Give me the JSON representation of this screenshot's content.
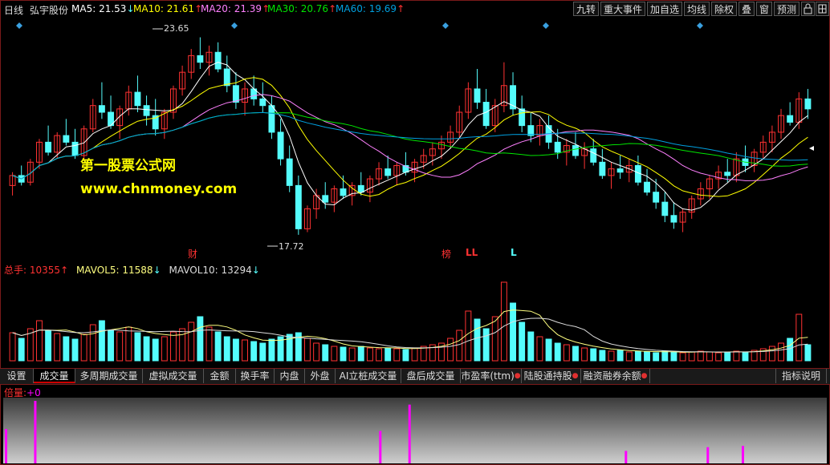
{
  "header": {
    "period": "日线",
    "stock_name": "弘宇股份",
    "ma5": {
      "label": "MA5:",
      "value": "21.53",
      "arrow": "↓"
    },
    "ma10": {
      "label": "MA10:",
      "value": "21.61",
      "arrow": "↑"
    },
    "ma20": {
      "label": "MA20:",
      "value": "21.39",
      "arrow": "↑"
    },
    "ma30": {
      "label": "MA30:",
      "value": "20.76",
      "arrow": "↑"
    },
    "ma60": {
      "label": "MA60:",
      "value": "19.69",
      "arrow": "↑"
    }
  },
  "toolbar": [
    "九转",
    "重大事件",
    "加自选",
    "均线",
    "除权",
    "叠",
    "窗",
    "预测"
  ],
  "chart": {
    "high_label": "23.65",
    "low_label": "17.72",
    "marker_cai": "财",
    "marker_bang": "榜",
    "marker_ll": "LL",
    "marker_l": "L",
    "watermark_cn": "第一股票公式网",
    "watermark_url": "www.chnmoney.com"
  },
  "volume": {
    "total_label": "总手:",
    "total_value": "10355",
    "total_arrow": "↑",
    "mavol5_label": "MAVOL5:",
    "mavol5_value": "11588",
    "mavol5_arrow": "↓",
    "mavol10_label": "MAVOL10:",
    "mavol10_value": "13294",
    "mavol10_arrow": "↓"
  },
  "tabs": [
    {
      "label": "设置",
      "dot": false
    },
    {
      "label": "成交量",
      "dot": false,
      "active": true
    },
    {
      "label": "多周期成交量",
      "dot": false
    },
    {
      "label": "虚拟成交量",
      "dot": false
    },
    {
      "label": "金额",
      "dot": false
    },
    {
      "label": "换手率",
      "dot": false
    },
    {
      "label": "内盘",
      "dot": false
    },
    {
      "label": "外盘",
      "dot": false
    },
    {
      "label": "AI立桩成交量",
      "dot": false
    },
    {
      "label": "盘后成交量",
      "dot": false
    },
    {
      "label": "市盈率(ttm)",
      "dot": true
    },
    {
      "label": "陆股通持股",
      "dot": true
    },
    {
      "label": "融资融券余额",
      "dot": true
    }
  ],
  "indicator_help": "指标说明",
  "bottom": {
    "label": "倍量:",
    "value": "+0"
  },
  "colors": {
    "up": "#ff3232",
    "down": "#54fcfc",
    "ma5": "#ffffff",
    "ma10": "#ffff00",
    "ma20": "#ff80ff",
    "ma30": "#00e600",
    "ma60": "#00a0e0",
    "bottom_bar": "#ff00ff"
  },
  "chart_data": {
    "type": "candlestick",
    "price_range": [
      17.5,
      24.0
    ],
    "candles": [
      [
        19.2,
        19.6,
        18.9,
        19.5
      ],
      [
        19.5,
        19.8,
        19.2,
        19.3
      ],
      [
        19.3,
        20.0,
        19.2,
        19.9
      ],
      [
        19.9,
        20.6,
        19.7,
        20.5
      ],
      [
        20.5,
        21.0,
        20.1,
        20.2
      ],
      [
        20.2,
        20.8,
        20.0,
        20.7
      ],
      [
        20.7,
        21.2,
        20.4,
        20.5
      ],
      [
        20.5,
        20.9,
        20.0,
        20.1
      ],
      [
        20.1,
        21.0,
        20.0,
        20.9
      ],
      [
        20.9,
        21.8,
        20.8,
        21.6
      ],
      [
        21.6,
        22.3,
        21.2,
        21.4
      ],
      [
        21.4,
        21.9,
        20.9,
        21.0
      ],
      [
        21.0,
        21.6,
        20.6,
        21.5
      ],
      [
        21.5,
        22.2,
        21.3,
        22.0
      ],
      [
        22.0,
        22.5,
        21.4,
        21.6
      ],
      [
        21.6,
        21.9,
        21.0,
        21.3
      ],
      [
        21.3,
        21.8,
        20.7,
        20.9
      ],
      [
        20.9,
        21.5,
        20.6,
        21.4
      ],
      [
        21.4,
        22.2,
        21.2,
        22.1
      ],
      [
        22.1,
        22.8,
        21.9,
        22.6
      ],
      [
        22.6,
        23.3,
        22.4,
        23.1
      ],
      [
        23.1,
        23.65,
        22.7,
        22.9
      ],
      [
        22.9,
        23.4,
        22.5,
        23.2
      ],
      [
        23.2,
        23.5,
        22.6,
        22.7
      ],
      [
        22.7,
        23.1,
        22.0,
        22.2
      ],
      [
        22.2,
        22.6,
        21.5,
        21.7
      ],
      [
        21.7,
        22.3,
        21.3,
        22.1
      ],
      [
        22.1,
        22.5,
        21.6,
        21.8
      ],
      [
        21.8,
        22.3,
        21.4,
        21.6
      ],
      [
        21.6,
        21.9,
        20.6,
        20.8
      ],
      [
        20.8,
        21.2,
        19.8,
        20.0
      ],
      [
        20.0,
        20.4,
        19.0,
        19.2
      ],
      [
        19.2,
        19.5,
        17.72,
        17.9
      ],
      [
        17.9,
        18.6,
        17.8,
        18.5
      ],
      [
        18.5,
        19.1,
        18.2,
        18.9
      ],
      [
        18.9,
        19.3,
        18.5,
        18.7
      ],
      [
        18.7,
        19.2,
        18.4,
        19.1
      ],
      [
        19.1,
        19.5,
        18.8,
        18.9
      ],
      [
        18.9,
        19.3,
        18.6,
        19.2
      ],
      [
        19.2,
        19.6,
        18.9,
        19.0
      ],
      [
        19.0,
        19.5,
        18.7,
        19.4
      ],
      [
        19.4,
        19.9,
        19.2,
        19.7
      ],
      [
        19.7,
        20.1,
        19.4,
        19.5
      ],
      [
        19.5,
        19.9,
        19.2,
        19.8
      ],
      [
        19.8,
        20.2,
        19.5,
        19.6
      ],
      [
        19.6,
        20.0,
        19.3,
        19.9
      ],
      [
        19.9,
        20.3,
        19.7,
        20.1
      ],
      [
        20.1,
        20.5,
        19.8,
        20.3
      ],
      [
        20.3,
        20.7,
        20.0,
        20.5
      ],
      [
        20.5,
        21.0,
        20.3,
        20.8
      ],
      [
        20.8,
        21.6,
        20.6,
        21.4
      ],
      [
        21.4,
        22.3,
        21.2,
        22.1
      ],
      [
        22.1,
        22.7,
        21.5,
        21.7
      ],
      [
        21.7,
        22.1,
        20.9,
        21.0
      ],
      [
        21.0,
        21.8,
        20.8,
        21.6
      ],
      [
        21.6,
        22.9,
        21.4,
        22.2
      ],
      [
        22.2,
        22.6,
        21.3,
        21.5
      ],
      [
        21.5,
        21.9,
        20.8,
        21.0
      ],
      [
        21.0,
        21.4,
        20.5,
        20.7
      ],
      [
        20.7,
        21.2,
        20.4,
        21.0
      ],
      [
        21.0,
        21.3,
        20.3,
        20.5
      ],
      [
        20.5,
        20.9,
        20.0,
        20.2
      ],
      [
        20.2,
        20.6,
        19.8,
        20.4
      ],
      [
        20.4,
        20.8,
        20.0,
        20.1
      ],
      [
        20.1,
        20.5,
        19.7,
        20.3
      ],
      [
        20.3,
        20.6,
        19.8,
        19.9
      ],
      [
        19.9,
        20.3,
        19.4,
        19.5
      ],
      [
        19.5,
        19.9,
        19.1,
        19.7
      ],
      [
        19.7,
        20.1,
        19.4,
        19.6
      ],
      [
        19.6,
        20.0,
        19.3,
        19.8
      ],
      [
        19.8,
        20.1,
        19.2,
        19.3
      ],
      [
        19.3,
        19.7,
        18.9,
        19.0
      ],
      [
        19.0,
        19.4,
        18.5,
        18.7
      ],
      [
        18.7,
        19.0,
        18.1,
        18.3
      ],
      [
        18.3,
        18.7,
        17.9,
        18.1
      ],
      [
        18.1,
        18.5,
        17.8,
        18.4
      ],
      [
        18.4,
        18.9,
        18.2,
        18.8
      ],
      [
        18.8,
        19.3,
        18.6,
        19.1
      ],
      [
        19.1,
        19.5,
        18.8,
        19.4
      ],
      [
        19.4,
        19.8,
        19.1,
        19.6
      ],
      [
        19.6,
        20.0,
        19.3,
        19.5
      ],
      [
        19.5,
        20.2,
        19.3,
        20.0
      ],
      [
        20.0,
        20.4,
        19.6,
        19.8
      ],
      [
        19.8,
        20.3,
        19.6,
        20.2
      ],
      [
        20.2,
        20.7,
        20.0,
        20.5
      ],
      [
        20.5,
        21.0,
        20.2,
        20.8
      ],
      [
        20.8,
        21.5,
        20.6,
        21.3
      ],
      [
        21.3,
        21.7,
        21.0,
        21.1
      ],
      [
        21.1,
        22.0,
        20.9,
        21.8
      ],
      [
        21.8,
        22.1,
        21.2,
        21.5
      ]
    ],
    "volume_ratio": [
      0.35,
      0.28,
      0.4,
      0.5,
      0.38,
      0.34,
      0.3,
      0.27,
      0.33,
      0.45,
      0.5,
      0.38,
      0.36,
      0.42,
      0.35,
      0.3,
      0.27,
      0.3,
      0.36,
      0.4,
      0.48,
      0.55,
      0.42,
      0.36,
      0.3,
      0.27,
      0.26,
      0.24,
      0.22,
      0.27,
      0.3,
      0.33,
      0.35,
      0.28,
      0.22,
      0.2,
      0.18,
      0.17,
      0.16,
      0.18,
      0.16,
      0.15,
      0.16,
      0.15,
      0.14,
      0.16,
      0.18,
      0.2,
      0.22,
      0.28,
      0.38,
      0.62,
      0.52,
      0.4,
      0.55,
      0.98,
      0.72,
      0.48,
      0.36,
      0.3,
      0.27,
      0.22,
      0.2,
      0.18,
      0.16,
      0.15,
      0.13,
      0.12,
      0.13,
      0.11,
      0.12,
      0.11,
      0.1,
      0.12,
      0.11,
      0.1,
      0.11,
      0.12,
      0.11,
      0.1,
      0.11,
      0.12,
      0.11,
      0.13,
      0.15,
      0.18,
      0.22,
      0.28,
      0.58,
      0.2
    ],
    "bottom_spikes": [
      [
        0,
        0.55
      ],
      [
        5,
        1.0
      ],
      [
        64,
        0.52
      ],
      [
        69,
        0.94
      ],
      [
        106,
        0.2
      ],
      [
        120,
        0.26
      ],
      [
        126,
        0.28
      ]
    ]
  }
}
